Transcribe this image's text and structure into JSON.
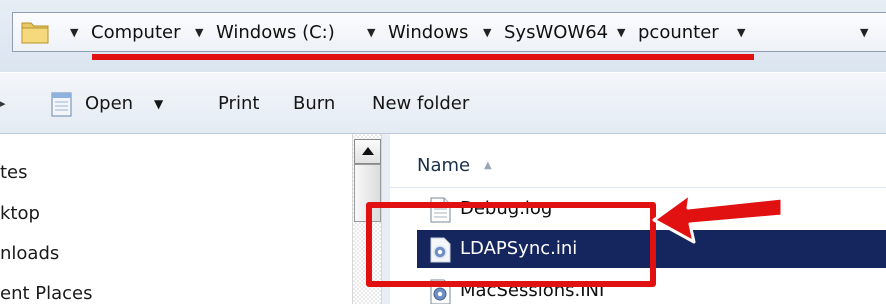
{
  "address_bar": {
    "crumbs": [
      "Computer",
      "Windows (C:)",
      "Windows",
      "SysWOW64",
      "pcounter"
    ]
  },
  "toolbar": {
    "open_label": "Open",
    "print_label": "Print",
    "burn_label": "Burn",
    "new_folder_label": "New folder"
  },
  "nav_pane": {
    "items": [
      "tes",
      "ktop",
      "nloads",
      "ent Places"
    ]
  },
  "file_list": {
    "column_name": "Name",
    "files": [
      {
        "name": "Debug.log",
        "icon": "text-file-icon"
      },
      {
        "name": "LDAPSync.ini",
        "icon": "settings-file-icon",
        "selected": true
      },
      {
        "name": "MacSessions.INI",
        "icon": "settings-file-icon"
      }
    ]
  },
  "annotations": {
    "highlight_color": "#e21111",
    "selection_color": "#15255e"
  }
}
